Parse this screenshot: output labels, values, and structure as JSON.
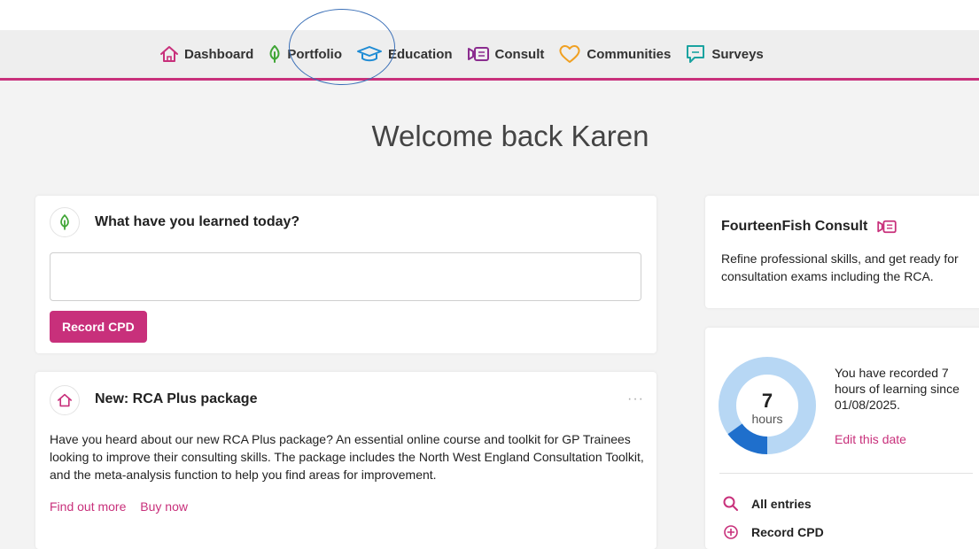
{
  "nav": {
    "items": [
      {
        "label": "Dashboard",
        "icon": "house-icon"
      },
      {
        "label": "Portfolio",
        "icon": "leaf-icon"
      },
      {
        "label": "Education",
        "icon": "graduation-cap-icon"
      },
      {
        "label": "Consult",
        "icon": "consult-icon"
      },
      {
        "label": "Communities",
        "icon": "heart-icon"
      },
      {
        "label": "Surveys",
        "icon": "chat-icon"
      }
    ]
  },
  "welcome": "Welcome back Karen",
  "cpd_card": {
    "title": "What have you learned today?",
    "input_value": "",
    "button": "Record CPD"
  },
  "news_card": {
    "title": "New: RCA Plus package",
    "menu": "···",
    "description": "Have you heard about our new RCA Plus package? An essential online course and toolkit for GP Trainees looking to improve their consulting skills. The package includes the North West England Consultation Toolkit, and the meta-analysis function to help you find areas for improvement.",
    "link_more": "Find out more",
    "link_buy": "Buy now"
  },
  "consult_card": {
    "title": "FourteenFish Consult",
    "description": "Refine professional skills, and get ready for consultation exams including the RCA."
  },
  "hours_card": {
    "hours_value": "7",
    "hours_unit": "hours",
    "progress_fraction": 0.15,
    "summary": "You have recorded 7 hours of learning since 01/08/2025.",
    "edit_link": "Edit this date",
    "menu": [
      {
        "label": "All entries",
        "icon": "search-icon"
      },
      {
        "label": "Record CPD",
        "icon": "plus-circle-icon"
      }
    ]
  },
  "colors": {
    "accent": "#c8307b",
    "donut_track": "#b7d7f4",
    "donut_fill": "#1f6fcc",
    "annotation": "#3a6fb7"
  }
}
